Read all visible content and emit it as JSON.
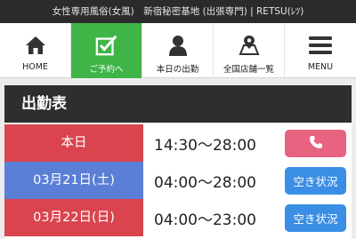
{
  "header": {
    "text": "女性専用風俗(女風)　新宿秘密基地 (出張専門) | RETSU(ﾚﾂ)"
  },
  "nav": [
    {
      "label": "HOME",
      "icon": "home-icon"
    },
    {
      "label": "ご予約へ",
      "icon": "checkbox-icon"
    },
    {
      "label": "本日の出勤",
      "icon": "person-icon"
    },
    {
      "label": "全国店舗一覧",
      "icon": "map-pin-icon"
    },
    {
      "label": "MENU",
      "icon": "hamburger-icon"
    }
  ],
  "colors": {
    "active_nav": "#3fb547",
    "today": "#d9444e",
    "saturday": "#5b7fd6",
    "sunday": "#d9444e",
    "tel_button": "#e8637f",
    "status_button": "#3a8ee6"
  },
  "schedule": {
    "title": "出勤表",
    "rows": [
      {
        "date": "本日",
        "time": "14:30〜28:00",
        "button": "",
        "button_icon": "phone-icon"
      },
      {
        "date": "03月21日(土)",
        "time": "04:00〜28:00",
        "button": "空き状況"
      },
      {
        "date": "03月22日(日)",
        "time": "04:00〜23:00",
        "button": "空き状況"
      }
    ]
  }
}
